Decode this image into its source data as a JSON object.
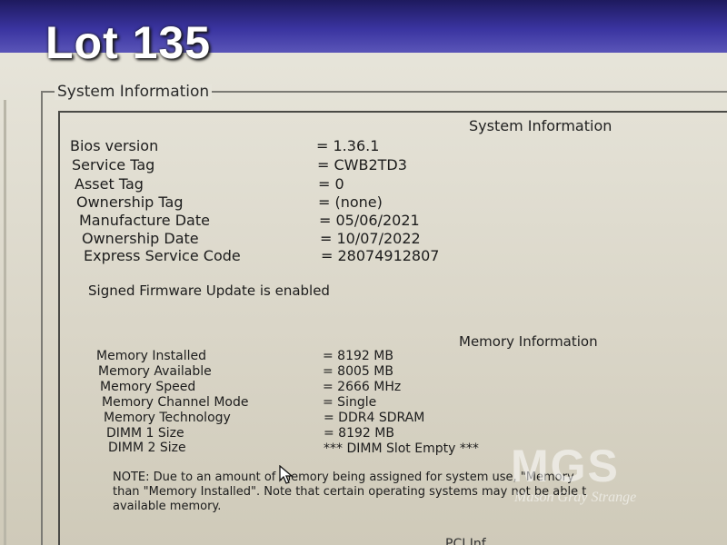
{
  "overlay": {
    "lot_label": "Lot 135"
  },
  "panel": {
    "title": "System Information"
  },
  "system_info": {
    "heading": "System Information",
    "rows": [
      {
        "label": "Bios version",
        "value": "= 1.36.1"
      },
      {
        "label": "Service Tag",
        "value": "= CWB2TD3"
      },
      {
        "label": "Asset Tag",
        "value": "= 0"
      },
      {
        "label": "Ownership Tag",
        "value": "= (none)"
      },
      {
        "label": "Manufacture Date",
        "value": "= 05/06/2021"
      },
      {
        "label": "Ownership Date",
        "value": "= 10/07/2022"
      },
      {
        "label": "Express Service Code",
        "value": "= 28074912807"
      }
    ],
    "firmware_status": "Signed Firmware Update is enabled"
  },
  "memory_info": {
    "heading": "Memory Information",
    "rows": [
      {
        "label": "Memory Installed",
        "value": "= 8192 MB"
      },
      {
        "label": "Memory Available",
        "value": "= 8005 MB"
      },
      {
        "label": "Memory Speed",
        "value": "= 2666 MHz"
      },
      {
        "label": "Memory Channel Mode",
        "value": "= Single"
      },
      {
        "label": "Memory Technology",
        "value": "= DDR4 SDRAM"
      },
      {
        "label": "DIMM 1 Size",
        "value": "= 8192 MB"
      },
      {
        "label": "DIMM 2 Size",
        "value": "*** DIMM Slot Empty ***"
      }
    ],
    "note_lines": [
      "NOTE: Due to an amount of memory being assigned for system use, \"Memory",
      "than \"Memory Installed\". Note that certain operating systems may not be able t",
      "available memory."
    ]
  },
  "watermark": {
    "logo": "MGS",
    "subtitle": "Mason Gray Strange"
  },
  "bottom_fragment": "PCI Inf",
  "colors": {
    "top_bar": "#3a34a0",
    "screen_bg": "#e2dfd3",
    "frame": "#4a4a46"
  }
}
